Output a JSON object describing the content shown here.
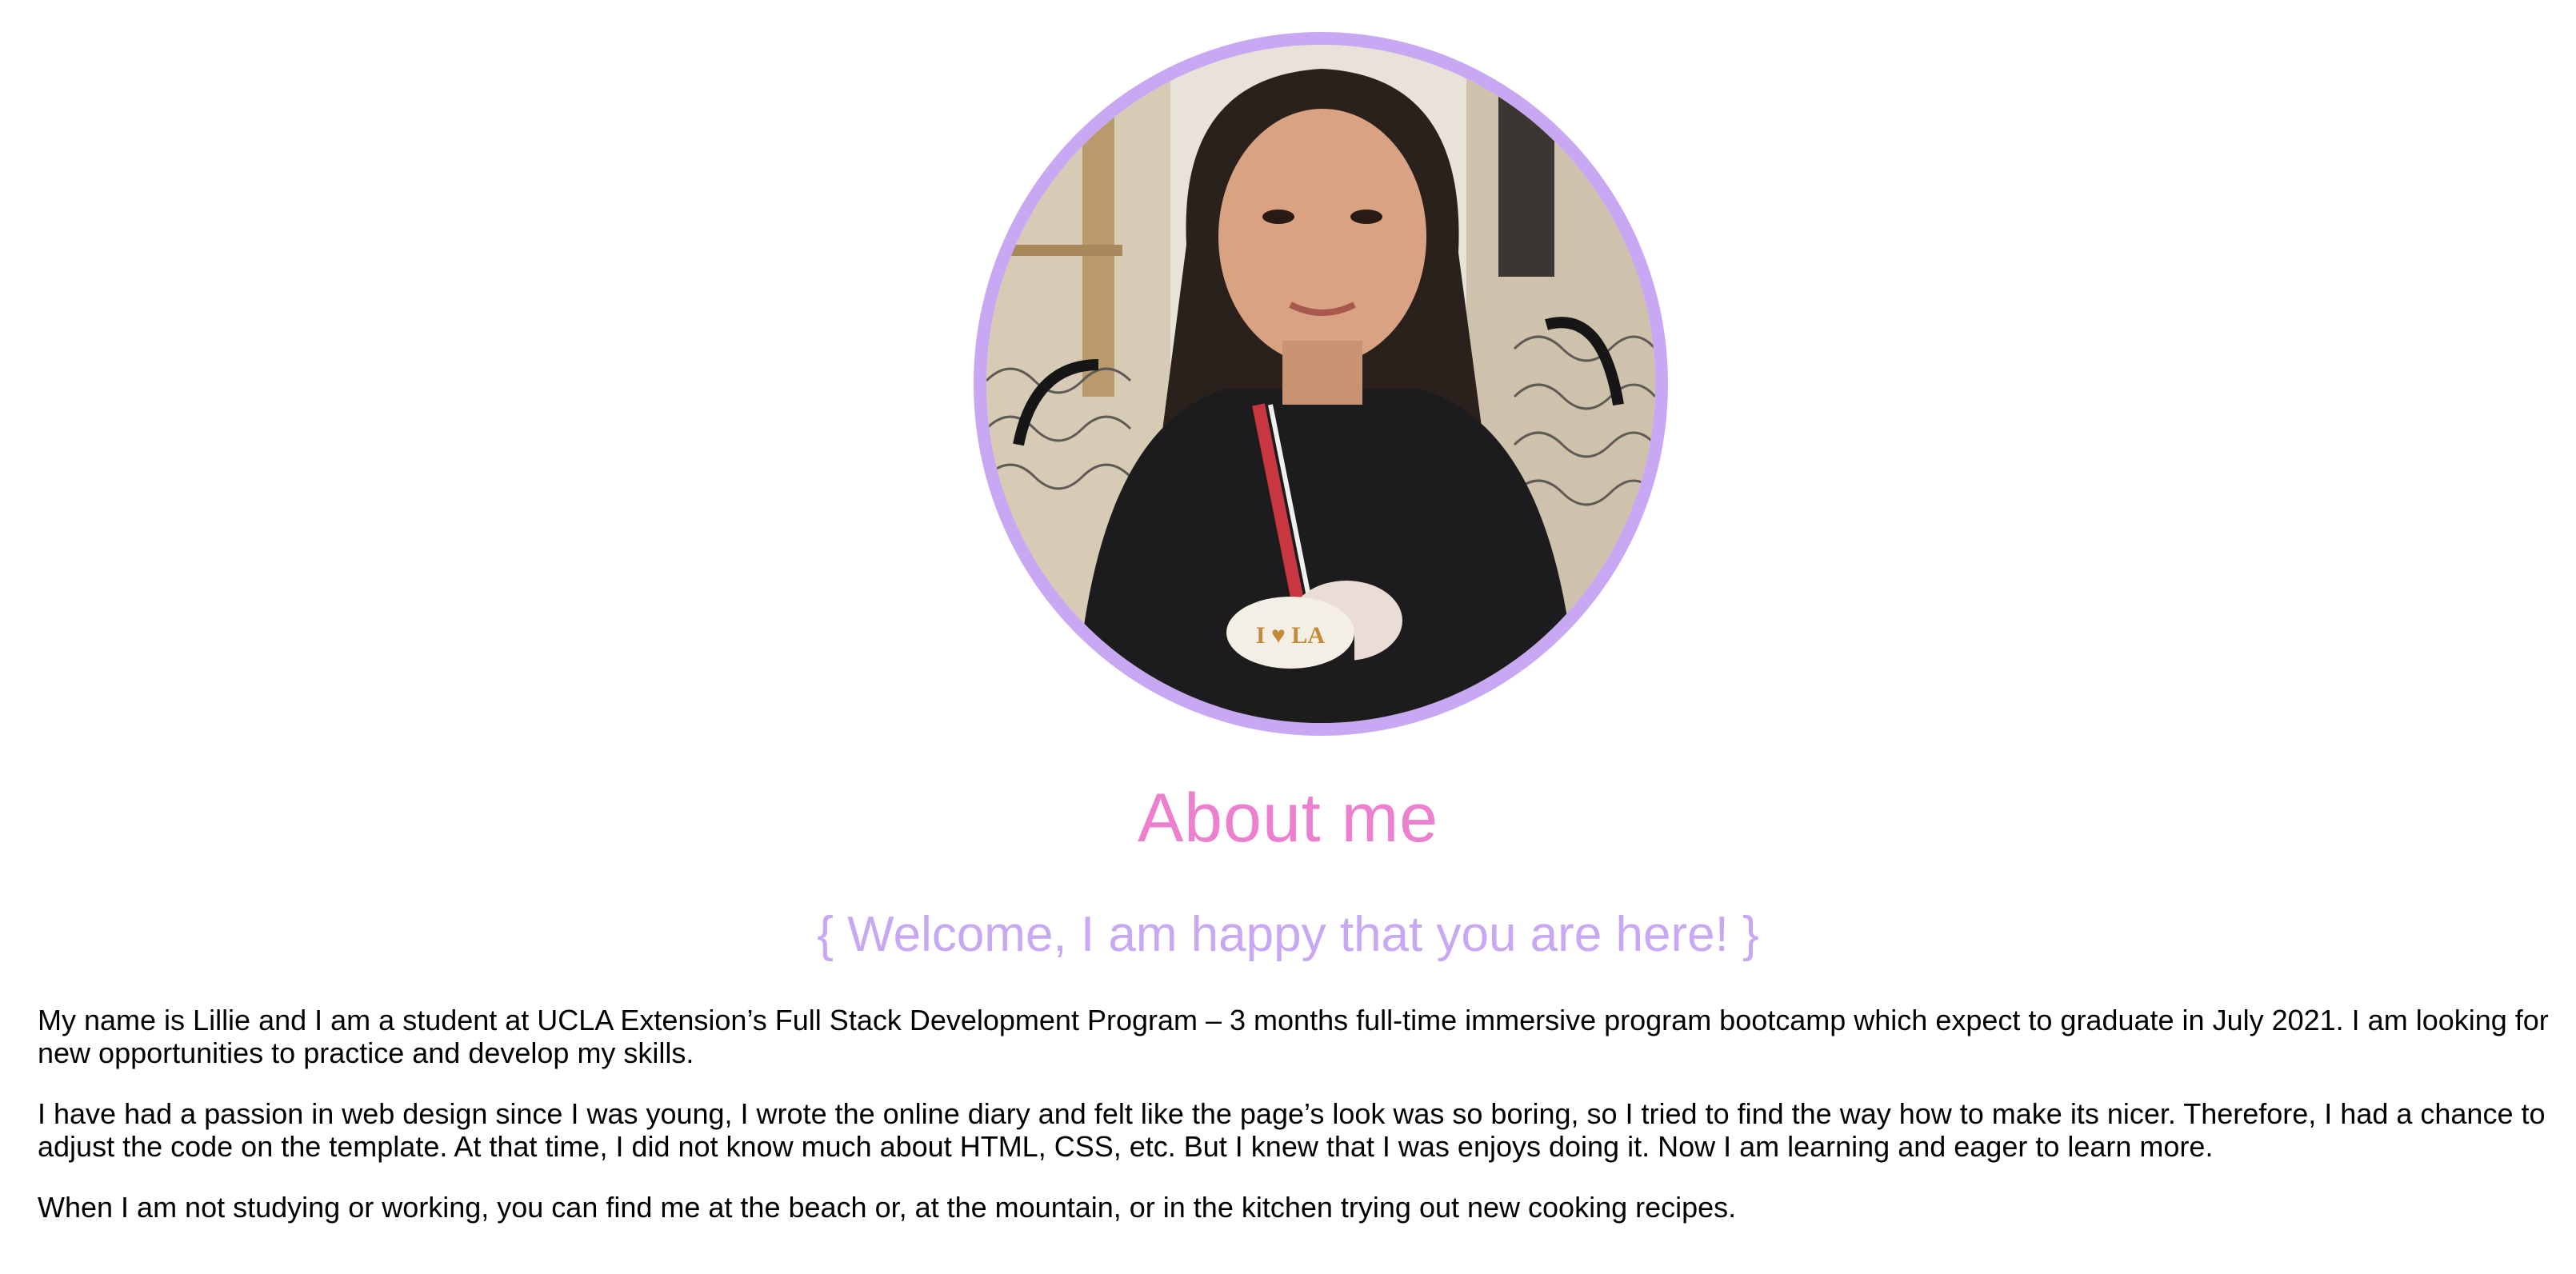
{
  "profile": {
    "photo_alt": "Lillie profile photo",
    "accent_color": "#c8a8f2"
  },
  "about": {
    "heading": "About me",
    "heading_color": "#ec7fce",
    "tagline": "{ Welcome, I am happy that you are here! }",
    "tagline_color": "#c8a8f2",
    "paragraphs": [
      "My name is Lillie and I am a student at UCLA Extension’s Full Stack Development Program – 3 months full-time immersive program bootcamp which expect to graduate in July 2021. I am looking for new opportunities to practice and develop my skills.",
      "I have had a passion in web design since I was young, I wrote the online diary and felt like the page’s look was so boring, so I tried to find the way how to make its nicer. Therefore, I had a chance to adjust the code on the template. At that time, I did not know much about HTML, CSS, etc. But I knew that I was enjoys doing it. Now I am learning and eager to learn more.",
      "When I am not studying or working, you can find me at the beach or, at the mountain, or in the kitchen trying out new cooking recipes."
    ]
  }
}
